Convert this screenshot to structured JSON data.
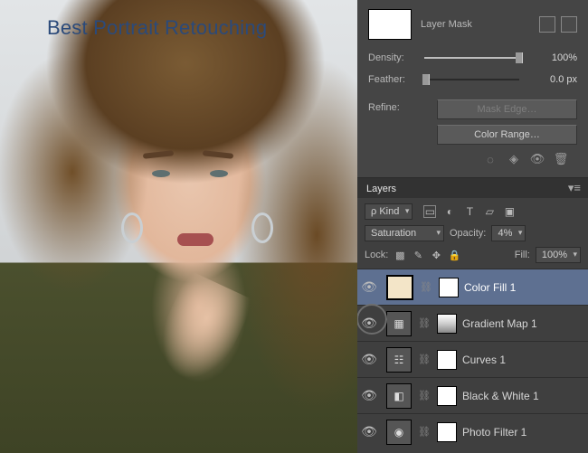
{
  "title_overlay": "Best Portrait Retouching",
  "props_panel": {
    "mask_label": "Layer Mask",
    "density": {
      "label": "Density:",
      "value": "100%",
      "percent": 100
    },
    "feather": {
      "label": "Feather:",
      "value": "0.0 px",
      "percent": 0
    },
    "refine": {
      "label": "Refine:",
      "mask_edge": "Mask Edge…",
      "color_range": "Color Range…"
    }
  },
  "layers_panel": {
    "tab": "Layers",
    "filter_kind": "Kind",
    "blend_mode": "Saturation",
    "opacity": {
      "label": "Opacity:",
      "value": "4%"
    },
    "lock_label": "Lock:",
    "fill": {
      "label": "Fill:",
      "value": "100%"
    },
    "layers": [
      {
        "name": "Color Fill 1",
        "visible": true,
        "selected": true,
        "thumb": "fill"
      },
      {
        "name": "Gradient Map 1",
        "visible": true,
        "selected": false,
        "thumb": "grad",
        "highlight_visibility": true
      },
      {
        "name": "Curves 1",
        "visible": true,
        "selected": false,
        "thumb": "adj"
      },
      {
        "name": "Black & White 1",
        "visible": true,
        "selected": false,
        "thumb": "adj"
      },
      {
        "name": "Photo Filter 1",
        "visible": true,
        "selected": false,
        "thumb": "adj"
      }
    ]
  }
}
